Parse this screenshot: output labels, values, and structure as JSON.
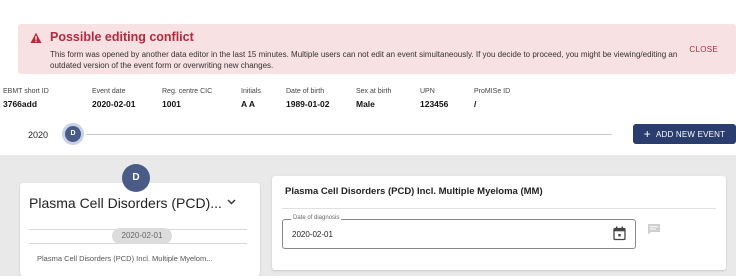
{
  "alert": {
    "title": "Possible editing conflict",
    "message": "This form was opened by another data editor in the last 15 minutes. Multiple users can not edit an event simultaneously. If you decide to proceed, you might be viewing/editing an outdated version of the event form or overwriting new changes.",
    "close_label": "CLOSE",
    "icon": "warning-icon",
    "color": "#b5293c"
  },
  "patient_info": {
    "fields": [
      {
        "label": "EBMT short ID",
        "value": "3766add"
      },
      {
        "label": "Event date",
        "value": "2020-02-01"
      },
      {
        "label": "Reg. centre CIC",
        "value": "1001"
      },
      {
        "label": "Initials",
        "value": "A A"
      },
      {
        "label": "Date of birth",
        "value": "1989-01-02"
      },
      {
        "label": "Sex at birth",
        "value": "Male"
      },
      {
        "label": "UPN",
        "value": "123456"
      },
      {
        "label": "ProMISe ID",
        "value": "/"
      }
    ]
  },
  "timeline": {
    "year": "2020",
    "event_marker": "D",
    "add_event_label": "ADD NEW EVENT",
    "accent": "#2a3d6e"
  },
  "left_panel": {
    "marker": "D",
    "title": "Plasma Cell Disorders (PCD)...",
    "date": "2020-02-01",
    "item": "Plasma Cell Disorders (PCD) Incl. Multiple Myelom..."
  },
  "right_panel": {
    "title": "Plasma Cell Disorders (PCD) Incl. Multiple Myeloma (MM)",
    "date_field": {
      "label": "Date of diagnosis",
      "value": "2020-02-01"
    }
  }
}
